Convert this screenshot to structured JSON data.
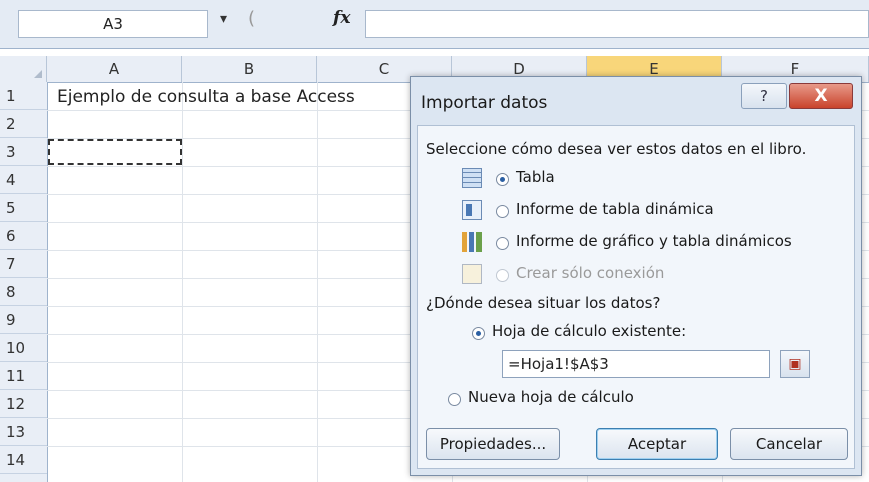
{
  "formula_bar": {
    "name_box": "A3",
    "dropdown_icon": "▾",
    "cancel_glyph": "(",
    "fx_label": "fx",
    "formula": ""
  },
  "columns": [
    "A",
    "B",
    "C",
    "D",
    "E",
    "F"
  ],
  "rows": [
    "1",
    "2",
    "3",
    "4",
    "5",
    "6",
    "7",
    "8",
    "9",
    "10",
    "11",
    "12",
    "13",
    "14"
  ],
  "cells": {
    "A1": "Ejemplo de consulta a base Access"
  },
  "dialog": {
    "title": "Importar datos",
    "help_label": "?",
    "close_label": "X",
    "view_prompt": "Seleccione cómo desea ver estos datos en el libro.",
    "view_options": [
      {
        "label": "Tabla",
        "selected": true,
        "enabled": true,
        "icon": "table-icon"
      },
      {
        "label": "Informe de tabla dinámica",
        "selected": false,
        "enabled": true,
        "icon": "pivot-table-icon"
      },
      {
        "label": "Informe de gráfico y tabla dinámicos",
        "selected": false,
        "enabled": true,
        "icon": "pivot-chart-icon"
      },
      {
        "label": "Crear sólo conexión",
        "selected": false,
        "enabled": false,
        "icon": "connection-icon"
      }
    ],
    "location_prompt": "¿Dónde desea situar los datos?",
    "location_options": [
      {
        "label": "Hoja de cálculo existente:",
        "selected": true
      },
      {
        "label": "Nueva hoja de cálculo",
        "selected": false
      }
    ],
    "reference": "=Hoja1!$A$3",
    "buttons": {
      "properties": "Propiedades...",
      "ok": "Aceptar",
      "cancel": "Cancelar"
    }
  }
}
